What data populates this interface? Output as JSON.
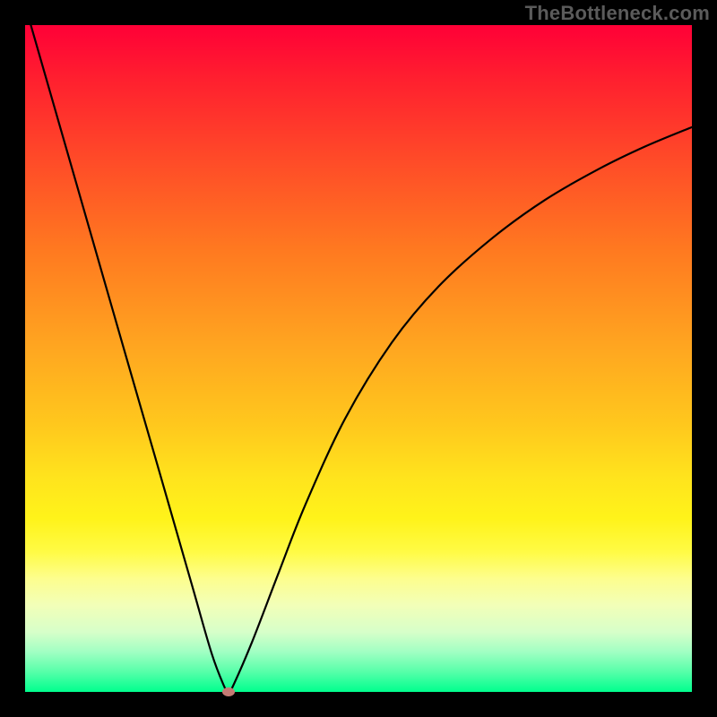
{
  "attribution": "TheBottleneck.com",
  "chart_data": {
    "type": "line",
    "title": "",
    "xlabel": "",
    "ylabel": "",
    "xlim": [
      0,
      1
    ],
    "ylim": [
      0,
      1
    ],
    "legend": false,
    "grid": false,
    "background": "rainbow-vertical-gradient",
    "series": [
      {
        "name": "bottleneck-curve",
        "color": "#000000",
        "x": [
          0.0,
          0.05,
          0.1,
          0.15,
          0.2,
          0.25,
          0.28,
          0.3,
          0.305,
          0.31,
          0.34,
          0.38,
          0.42,
          0.48,
          0.55,
          0.62,
          0.7,
          0.78,
          0.86,
          0.93,
          1.0
        ],
        "y": [
          1.03,
          0.856,
          0.682,
          0.508,
          0.335,
          0.161,
          0.057,
          0.005,
          0.0,
          0.005,
          0.074,
          0.178,
          0.28,
          0.41,
          0.524,
          0.608,
          0.68,
          0.738,
          0.784,
          0.818,
          0.847
        ]
      }
    ],
    "marker": {
      "x": 0.305,
      "y": 0.0,
      "color": "#c47a74"
    }
  },
  "colors": {
    "frame": "#000000",
    "curve": "#000000",
    "marker": "#c47a74",
    "attribution": "#5b5b5b"
  }
}
